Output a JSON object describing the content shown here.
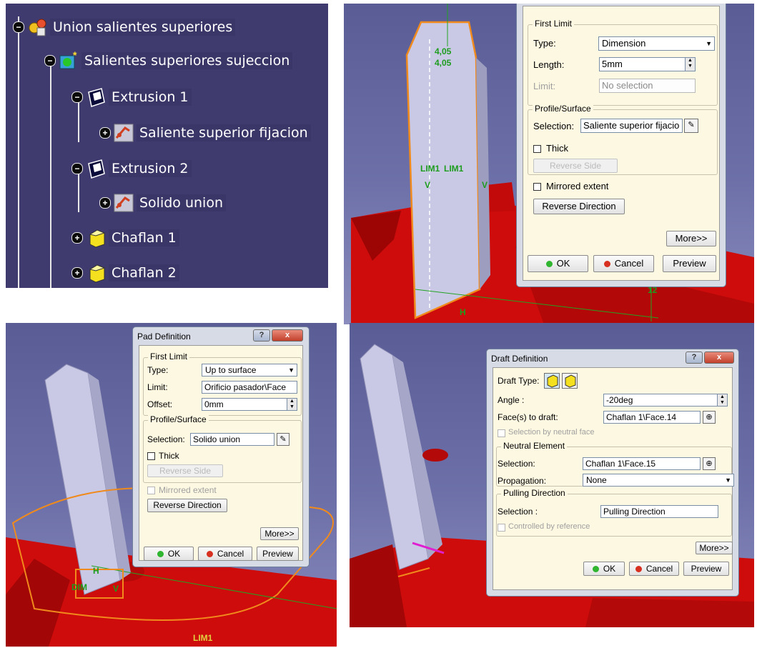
{
  "tree": {
    "items": [
      {
        "label": "Union salientes superiores",
        "expander": "−",
        "icon": "product-body-icon"
      },
      {
        "label": "Salientes superiores sujeccion",
        "expander": "−",
        "icon": "geometric-set-icon"
      },
      {
        "label": "Extrusion 1",
        "expander": "−",
        "icon": "pad-icon"
      },
      {
        "label": "Saliente superior fijacion",
        "expander": "+",
        "icon": "sketch-icon"
      },
      {
        "label": "Extrusion 2",
        "expander": "−",
        "icon": "pad-icon"
      },
      {
        "label": "Solido union",
        "expander": "+",
        "icon": "sketch-icon"
      },
      {
        "label": "Chaflan 1",
        "expander": "+",
        "icon": "chamfer-icon"
      },
      {
        "label": "Chaflan 2",
        "expander": "+",
        "icon": "chamfer-icon"
      }
    ]
  },
  "pad1": {
    "first_limit": "First Limit",
    "type_label": "Type:",
    "type_value": "Dimension",
    "length_label": "Length:",
    "length_value": "5mm",
    "limit_label": "Limit:",
    "limit_value": "No selection",
    "profile_surface": "Profile/Surface",
    "selection_label": "Selection:",
    "selection_value": "Saliente superior fijacio",
    "thick": "Thick",
    "reverse_side": "Reverse Side",
    "mirrored_extent": "Mirrored extent",
    "reverse_direction": "Reverse Direction",
    "more": "More>>",
    "ok": "OK",
    "cancel": "Cancel",
    "preview": "Preview",
    "dims": {
      "d1": "4,05",
      "d2": "4,05",
      "lim": "LIM1",
      "lim2": "LIM1",
      "v": "V",
      "v2": "V",
      "h": "H",
      "twelve": "12"
    }
  },
  "pad2": {
    "title": "Pad Definition",
    "win_help": "?",
    "win_close": "x",
    "first_limit": "First Limit",
    "type_label": "Type:",
    "type_value": "Up to surface",
    "limit_label": "Limit:",
    "limit_value": "Orificio pasador\\Face",
    "offset_label": "Offset:",
    "offset_value": "0mm",
    "profile_surface": "Profile/Surface",
    "selection_label": "Selection:",
    "selection_value": "Solido union",
    "thick": "Thick",
    "reverse_side": "Reverse Side",
    "mirrored_extent": "Mirrored extent",
    "reverse_direction": "Reverse Direction",
    "more": "More>>",
    "ok": "OK",
    "cancel": "Cancel",
    "preview": "Preview",
    "cad": {
      "lim": "LIM1",
      "h": "H",
      "v": "V",
      "dim": "DIM"
    }
  },
  "draft": {
    "title": "Draft Definition",
    "win_help": "?",
    "win_close": "x",
    "draft_type_label": "Draft Type:",
    "angle_label": "Angle :",
    "angle_value": "-20deg",
    "faces_label": "Face(s) to draft:",
    "faces_value": "Chaflan 1\\Face.14",
    "selection_by_neutral": "Selection by neutral face",
    "neutral_element": "Neutral Element",
    "selection_label": "Selection:",
    "selection_value": "Chaflan 1\\Face.15",
    "propagation_label": "Propagation:",
    "propagation_value": "None",
    "pulling_direction": "Pulling Direction",
    "pulling_selection_label": "Selection :",
    "pulling_selection_value": "Pulling Direction",
    "controlled_by_reference": "Controlled by reference",
    "more": "More>>",
    "ok": "OK",
    "cancel": "Cancel",
    "preview": "Preview"
  },
  "colors": {
    "ok_dot": "#2fb52f",
    "cancel_dot": "#d83020",
    "part_red": "#d40d0d",
    "highlight_orange": "#f08a1c"
  }
}
